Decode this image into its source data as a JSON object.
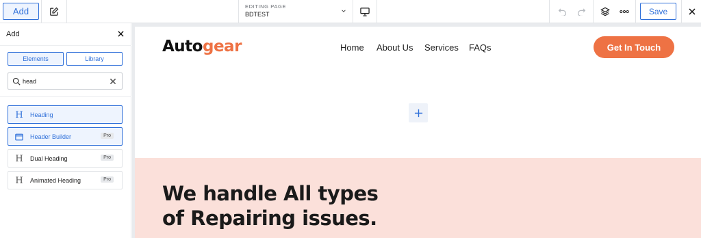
{
  "toolbar": {
    "add_label": "Add",
    "editing_label": "EDITING PAGE",
    "page_name": "BDTEST",
    "save_label": "Save"
  },
  "panel": {
    "title": "Add",
    "tabs": [
      "Elements",
      "Library"
    ],
    "search": {
      "value": "head"
    },
    "items": [
      {
        "label": "Heading",
        "badge": "",
        "icon": "heading-icon",
        "selected": true
      },
      {
        "label": "Header Builder",
        "badge": "Pro",
        "icon": "header-builder-icon",
        "selected": true
      },
      {
        "label": "Dual Heading",
        "badge": "Pro",
        "icon": "heading-icon",
        "selected": false
      },
      {
        "label": "Animated Heading",
        "badge": "Pro",
        "icon": "heading-icon",
        "selected": false
      }
    ]
  },
  "site": {
    "logo_main": "Auto",
    "logo_accent": "gear",
    "nav": [
      "Home",
      "About Us",
      "Services",
      "FAQs"
    ],
    "cta": "Get In Touch",
    "hero_line1": "We handle All types",
    "hero_line2": "of Repairing issues."
  },
  "colors": {
    "accent_blue": "#2e6fd9",
    "brand_orange": "#ee7244",
    "hero_bg": "#fbe0da"
  }
}
